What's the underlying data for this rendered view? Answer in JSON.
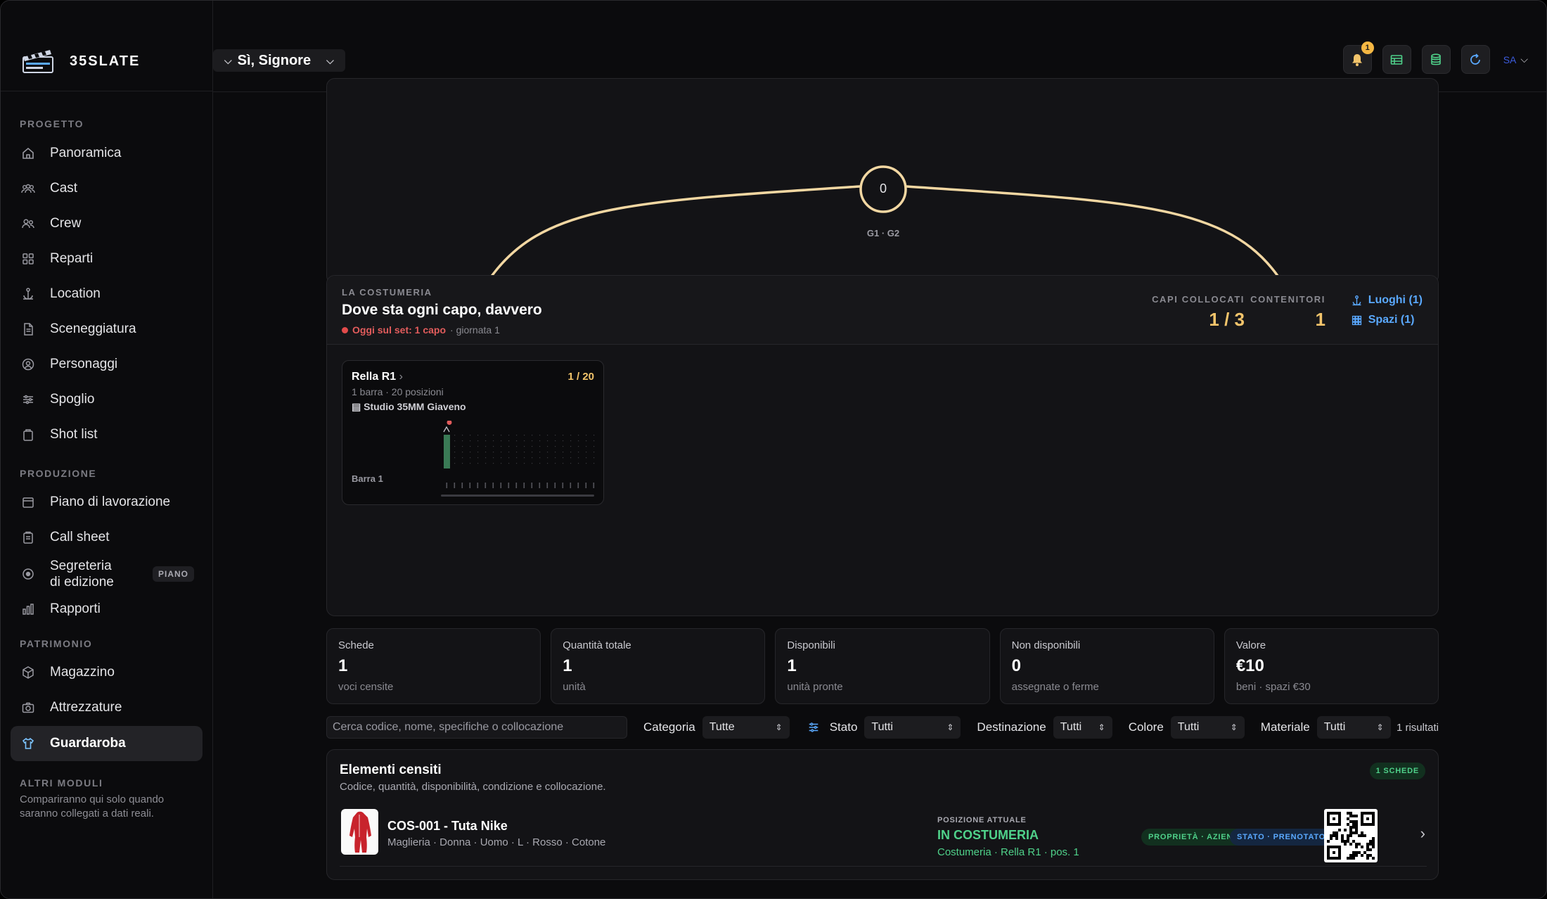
{
  "brand": {
    "name": "35SLATE"
  },
  "header": {
    "project": "Sì, Signore",
    "notif_count": "1",
    "user_initials": "SA"
  },
  "sidebar": {
    "sections": {
      "progetto": "PROGETTO",
      "produzione": "PRODUZIONE",
      "patrimonio": "PATRIMONIO"
    },
    "items": [
      {
        "label": "Panoramica",
        "icon": "home-icon"
      },
      {
        "label": "Cast",
        "icon": "people-icon"
      },
      {
        "label": "Crew",
        "icon": "users-icon"
      },
      {
        "label": "Reparti",
        "icon": "grid-icon"
      },
      {
        "label": "Location",
        "icon": "anchor-icon"
      },
      {
        "label": "Sceneggiatura",
        "icon": "document-icon"
      },
      {
        "label": "Personaggi",
        "icon": "user-circle-icon"
      },
      {
        "label": "Spoglio",
        "icon": "sliders-icon"
      },
      {
        "label": "Shot list",
        "icon": "clipboard-icon"
      },
      {
        "label": "Piano di lavorazione",
        "icon": "calendar-icon"
      },
      {
        "label": "Call sheet",
        "icon": "clipboard-icon"
      },
      {
        "label": "Segreteria",
        "label2": "di edizione",
        "badge": "PIANO",
        "icon": "record-icon"
      },
      {
        "label": "Rapporti",
        "icon": "bar-chart-icon"
      },
      {
        "label": "Magazzino",
        "icon": "box-icon"
      },
      {
        "label": "Attrezzature",
        "icon": "camera-icon"
      },
      {
        "label": "Guardaroba",
        "icon": "shirt-icon"
      }
    ],
    "other": {
      "title": "ALTRI MODULI",
      "text": "Compariranno qui solo quando saranno collegati a dati reali."
    }
  },
  "arc": {
    "center_value": "0",
    "center_label": "G1 · G2"
  },
  "costumeria": {
    "kicker": "LA COSTUMERIA",
    "title": "Dove sta ogni capo, davvero",
    "today": "Oggi sul set: 1 capo",
    "day": "· giornata 1",
    "capi_label": "CAPI COLLOCATI",
    "capi_value": "1 / 3",
    "cont_label": "CONTENITORI",
    "cont_value": "1",
    "luoghi": "Luoghi (1)",
    "spazi": "Spazi (1)",
    "rack": {
      "title": "Rella R1",
      "count": "1 / 20",
      "line2": "1 barra · 20 posizioni",
      "studio": "Studio 35MM Giaveno",
      "bar_label": "Barra 1",
      "occupied": 1,
      "positions": 20
    }
  },
  "metrics": [
    {
      "label": "Schede",
      "value": "1",
      "hint": "voci censite"
    },
    {
      "label": "Quantità totale",
      "value": "1",
      "hint": "unità"
    },
    {
      "label": "Disponibili",
      "value": "1",
      "hint": "unità pronte"
    },
    {
      "label": "Non disponibili",
      "value": "0",
      "hint": "assegnate o ferme"
    },
    {
      "label": "Valore",
      "value": "€10",
      "hint": "beni · spazi €30"
    }
  ],
  "filters": {
    "search_placeholder": "Cerca codice, nome, specifiche o collocazione",
    "categoria": {
      "label": "Categoria",
      "value": "Tutte"
    },
    "stato": {
      "label": "Stato",
      "value": "Tutti"
    },
    "destinazione": {
      "label": "Destinazione",
      "value": "Tutti"
    },
    "colore": {
      "label": "Colore",
      "value": "Tutti"
    },
    "materiale": {
      "label": "Materiale",
      "value": "Tutti"
    },
    "results": "1 risultati"
  },
  "list": {
    "title": "Elementi censiti",
    "desc": "Codice, quantità, disponibilità, condizione e collocazione.",
    "badge": "1 SCHEDE",
    "rows": [
      {
        "code": "COS-001 - Tuta Nike",
        "meta": "Maglieria · Donna · Uomo · L · Rosso · Cotone",
        "pos_label": "POSIZIONE ATTUALE",
        "pos_value": "IN COSTUMERIA",
        "pos_detail": "Costumeria · Rella R1 · pos. 1",
        "tag1": "PROPRIETÀ · AZIENDA",
        "tag2": "STATO · PRENOTATO"
      }
    ]
  }
}
